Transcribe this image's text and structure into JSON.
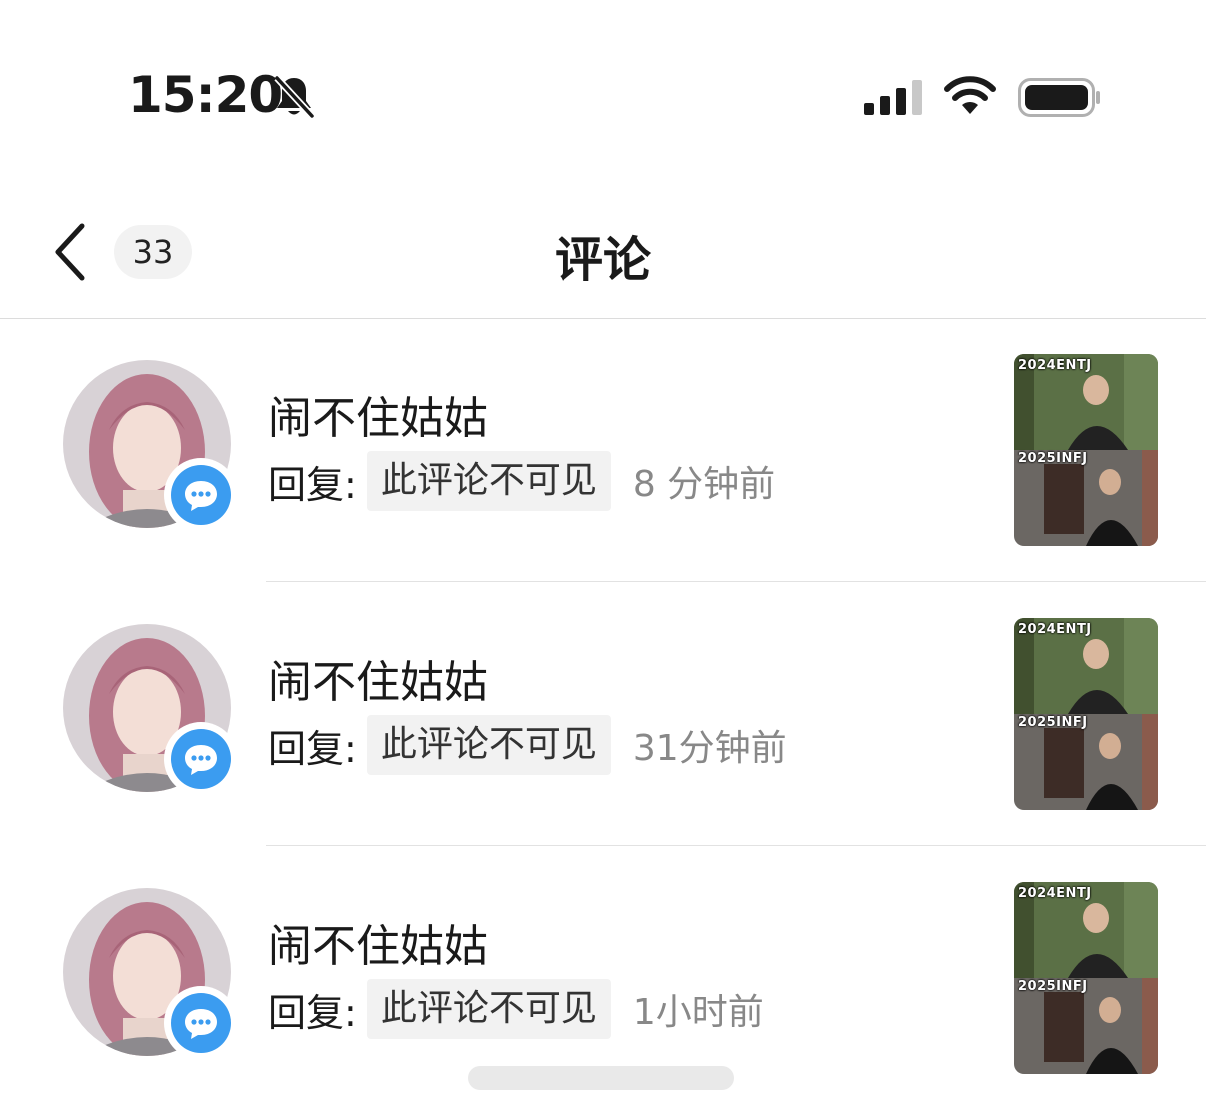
{
  "status_bar": {
    "time": "15:20",
    "icons": [
      "bell-slash-icon",
      "cellular-signal-icon",
      "wifi-icon",
      "battery-icon"
    ]
  },
  "nav": {
    "back_icon": "chevron-left-icon",
    "count": "33",
    "title": "评论"
  },
  "comments": [
    {
      "username": "闹不住姑姑",
      "reply_label": "回复:",
      "reply_content": "此评论不可见",
      "time_ago": "8 分钟前",
      "thumb_top_label": "2024ENTJ",
      "thumb_bottom_label": "2025INFJ"
    },
    {
      "username": "闹不住姑姑",
      "reply_label": "回复:",
      "reply_content": "此评论不可见",
      "time_ago": "31分钟前",
      "thumb_top_label": "2024ENTJ",
      "thumb_bottom_label": "2025INFJ"
    },
    {
      "username": "闹不住姑姑",
      "reply_label": "回复:",
      "reply_content": "此评论不可见",
      "time_ago": "1小时前",
      "thumb_top_label": "2024ENTJ",
      "thumb_bottom_label": "2025INFJ"
    }
  ],
  "colors": {
    "accent_blue": "#3b9cf0",
    "secondary_text": "#888888",
    "divider": "#e2e2e2"
  }
}
